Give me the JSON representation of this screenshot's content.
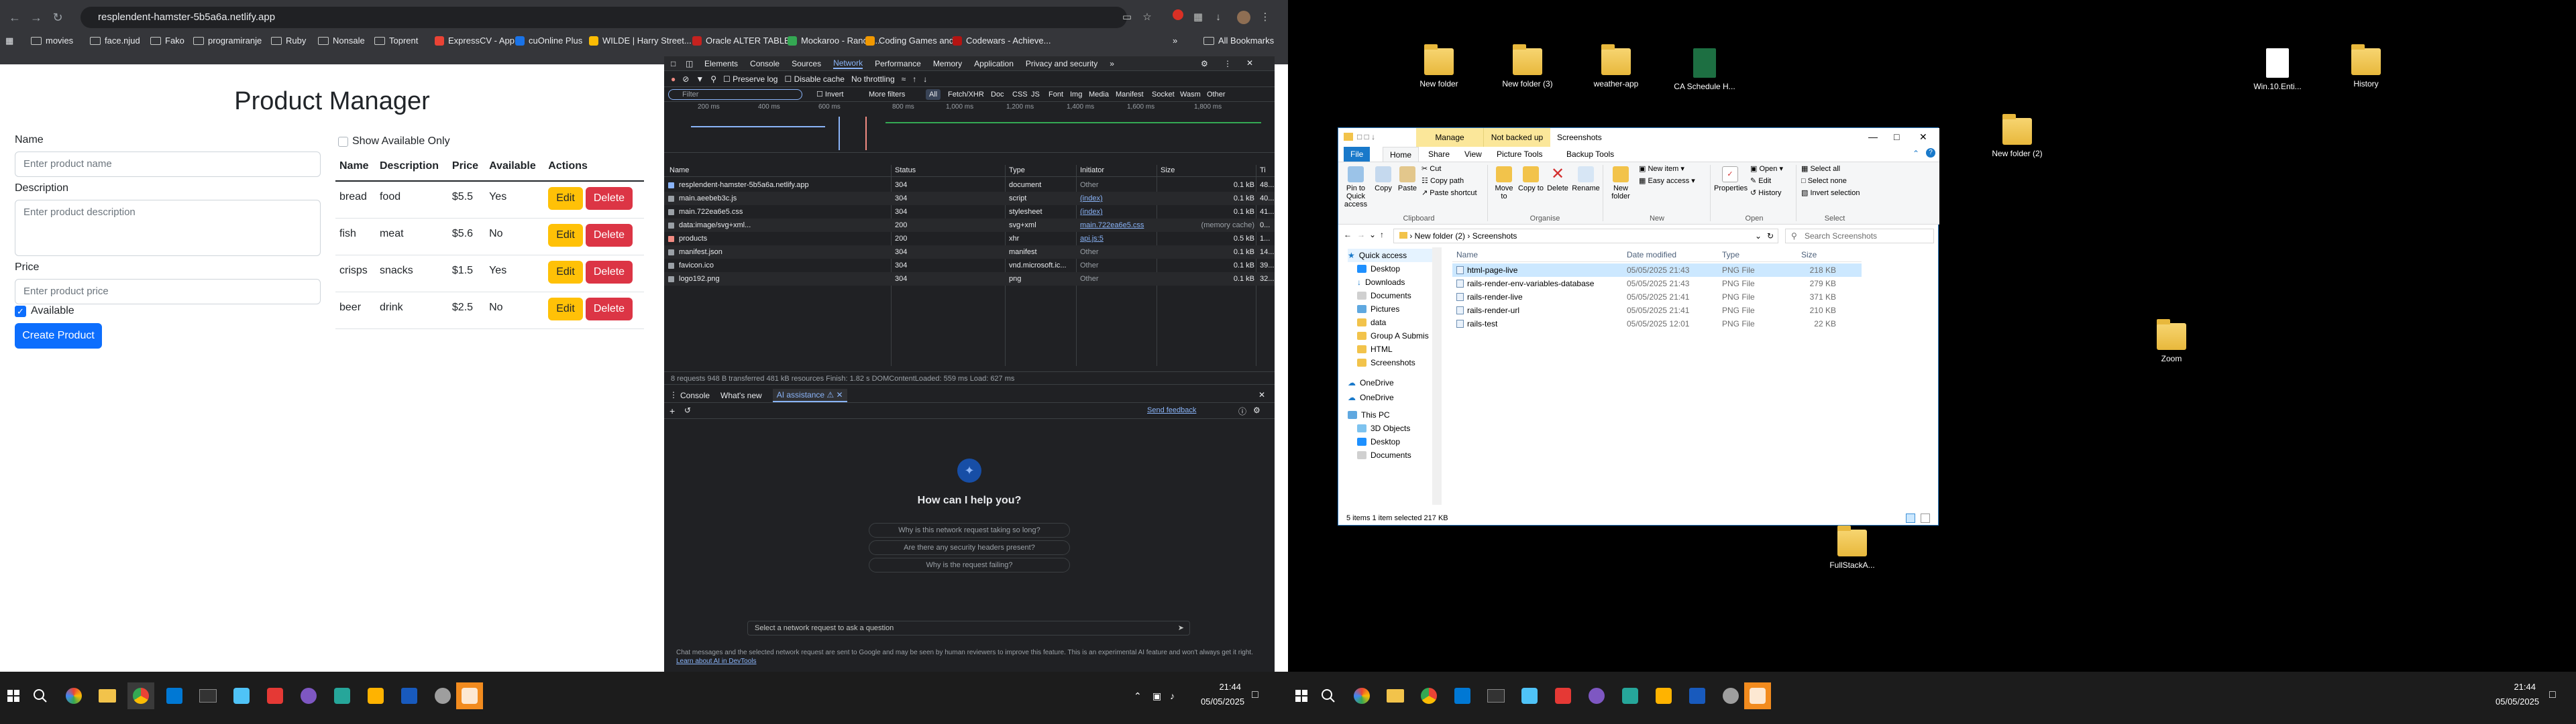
{
  "browser": {
    "url": "resplendent-hamster-5b5a6a.netlify.app",
    "bookmarks": [
      "movies",
      "face.njud",
      "Fako",
      "programiranje",
      "Ruby",
      "Nonsale",
      "Toprent",
      "ExpressCV - App...",
      "cuOnline Plus",
      "WILDE | Harry Street...",
      "Oracle ALTER TABLE...",
      "Mockaroo - Rando...",
      "Coding Games and...",
      "Codewars - Achieve..."
    ],
    "all_bookmarks": "All Bookmarks"
  },
  "app": {
    "title": "Product Manager",
    "name_label": "Name",
    "name_placeholder": "Enter product name",
    "description_label": "Description",
    "description_placeholder": "Enter product description",
    "price_label": "Price",
    "price_placeholder": "Enter product price",
    "available_label": "Available",
    "create_button": "Create Product",
    "show_available_label": "Show Available Only",
    "table_headers": [
      "Name",
      "Description",
      "Price",
      "Available",
      "Actions"
    ],
    "products": [
      {
        "name": "bread",
        "description": "food",
        "price": "$5.5",
        "available": "Yes"
      },
      {
        "name": "fish",
        "description": "meat",
        "price": "$5.6",
        "available": "No"
      },
      {
        "name": "crisps",
        "description": "snacks",
        "price": "$1.5",
        "available": "Yes"
      },
      {
        "name": "beer",
        "description": "drink",
        "price": "$2.5",
        "available": "No"
      }
    ],
    "edit_label": "Edit",
    "delete_label": "Delete"
  },
  "devtools": {
    "tabs": [
      "Elements",
      "Console",
      "Sources",
      "Network",
      "Performance",
      "Memory",
      "Application",
      "Privacy and security"
    ],
    "active_tab": "Network",
    "toolbar": {
      "preserve_log": "Preserve log",
      "disable_cache": "Disable cache",
      "throttling": "No throttling"
    },
    "filter_placeholder": "Filter",
    "invert": "Invert",
    "more_filters": "More filters",
    "filter_types": [
      "All",
      "Fetch/XHR",
      "Doc",
      "CSS",
      "JS",
      "Font",
      "Img",
      "Media",
      "Manifest",
      "Socket",
      "Wasm",
      "Other"
    ],
    "timeline_ticks": [
      "200 ms",
      "400 ms",
      "600 ms",
      "800 ms",
      "1,000 ms",
      "1,200 ms",
      "1,400 ms",
      "1,600 ms",
      "1,800 ms"
    ],
    "columns": [
      "Name",
      "Status",
      "Type",
      "Initiator",
      "Size",
      "Ti"
    ],
    "requests": [
      {
        "name": "resplendent-hamster-5b5a6a.netlify.app",
        "status": "304",
        "type": "document",
        "initiator": "Other",
        "size": "0.1 kB",
        "time": "48..."
      },
      {
        "name": "main.aeebeb3c.js",
        "status": "304",
        "type": "script",
        "initiator": "(index)",
        "size": "0.1 kB",
        "time": "40..."
      },
      {
        "name": "main.722ea6e5.css",
        "status": "304",
        "type": "stylesheet",
        "initiator": "(index)",
        "size": "0.1 kB",
        "time": "41..."
      },
      {
        "name": "data:image/svg+xml...",
        "status": "200",
        "type": "svg+xml",
        "initiator": "main.722ea6e5.css",
        "size": "(memory cache)",
        "time": "0..."
      },
      {
        "name": "products",
        "status": "200",
        "type": "xhr",
        "initiator": "api.js:5",
        "size": "0.5 kB",
        "time": "1..."
      },
      {
        "name": "manifest.json",
        "status": "304",
        "type": "manifest",
        "initiator": "Other",
        "size": "0.1 kB",
        "time": "14..."
      },
      {
        "name": "favicon.ico",
        "status": "304",
        "type": "vnd.microsoft.ic...",
        "initiator": "Other",
        "size": "0.1 kB",
        "time": "39..."
      },
      {
        "name": "logo192.png",
        "status": "304",
        "type": "png",
        "initiator": "Other",
        "size": "0.1 kB",
        "time": "32..."
      }
    ],
    "status_bar": "8 requests   948 B transferred   481 kB resources   Finish: 1.82 s   DOMContentLoaded: 559 ms   Load: 627 ms",
    "drawer_tabs": [
      "Console",
      "What's new",
      "AI assistance"
    ],
    "send_feedback": "Send feedback",
    "ai_heading": "How can I help you?",
    "suggestions": [
      "Why is this network request taking so long?",
      "Are there any security headers present?",
      "Why is the request failing?"
    ],
    "ai_input_placeholder": "Select a network request to ask a question",
    "ai_disclaimer": "Chat messages and the selected network request are sent to Google and may be seen by human reviewers to improve this feature. This is an experimental AI feature and won't always get it right.",
    "ai_disclaimer_link": "Learn about AI in DevTools"
  },
  "taskbar": {
    "time": "21:44",
    "date": "05/05/2025"
  },
  "desktop": {
    "icons": [
      {
        "label": "New folder",
        "kind": "folder"
      },
      {
        "label": "New folder (3)",
        "kind": "folder"
      },
      {
        "label": "weather-app",
        "kind": "folder"
      },
      {
        "label": "CA Schedule H...",
        "kind": "excel"
      },
      {
        "label": "Win.10.Enti...",
        "kind": "doc"
      },
      {
        "label": "History",
        "kind": "folder"
      },
      {
        "label": "New folder (2)",
        "kind": "folder"
      },
      {
        "label": "Zoom",
        "kind": "folder"
      },
      {
        "label": "FullStackA...",
        "kind": "folder"
      }
    ]
  },
  "explorer": {
    "window_title": "Screenshots",
    "manage_tab": "Manage",
    "not_backed_up": "Not backed up",
    "tabs": [
      "File",
      "Home",
      "Share",
      "View",
      "Picture Tools",
      "Backup Tools"
    ],
    "ribbon": {
      "pin": "Pin to Quick access",
      "copy": "Copy",
      "paste": "Paste",
      "cut": "Cut",
      "copy_path": "Copy path",
      "paste_shortcut": "Paste shortcut",
      "move_to": "Move to",
      "copy_to": "Copy to",
      "delete": "Delete",
      "rename": "Rename",
      "new_folder": "New folder",
      "new_item": "New item",
      "easy_access": "Easy access",
      "properties": "Properties",
      "open": "Open",
      "edit": "Edit",
      "history": "History",
      "select_all": "Select all",
      "select_none": "Select none",
      "invert_selection": "Invert selection",
      "groups": [
        "Clipboard",
        "Organise",
        "New",
        "Open",
        "Select"
      ]
    },
    "path": [
      "New folder (2)",
      "Screenshots"
    ],
    "search_placeholder": "Search Screenshots",
    "nav": [
      "Quick access",
      "Desktop",
      "Downloads",
      "Documents",
      "Pictures",
      "data",
      "Group A Submis",
      "HTML",
      "Screenshots",
      "OneDrive",
      "OneDrive",
      "This PC",
      "3D Objects",
      "Desktop",
      "Documents"
    ],
    "columns": [
      "Name",
      "Date modified",
      "Type",
      "Size"
    ],
    "files": [
      {
        "name": "html-page-live",
        "date": "05/05/2025 21:43",
        "type": "PNG File",
        "size": "218 KB"
      },
      {
        "name": "rails-render-env-variables-database",
        "date": "05/05/2025 21:43",
        "type": "PNG File",
        "size": "279 KB"
      },
      {
        "name": "rails-render-live",
        "date": "05/05/2025 21:41",
        "type": "PNG File",
        "size": "371 KB"
      },
      {
        "name": "rails-render-url",
        "date": "05/05/2025 21:41",
        "type": "PNG File",
        "size": "210 KB"
      },
      {
        "name": "rails-test",
        "date": "05/05/2025 12:01",
        "type": "PNG File",
        "size": "22 KB"
      }
    ],
    "status": "5 items    1 item selected  217 KB"
  }
}
